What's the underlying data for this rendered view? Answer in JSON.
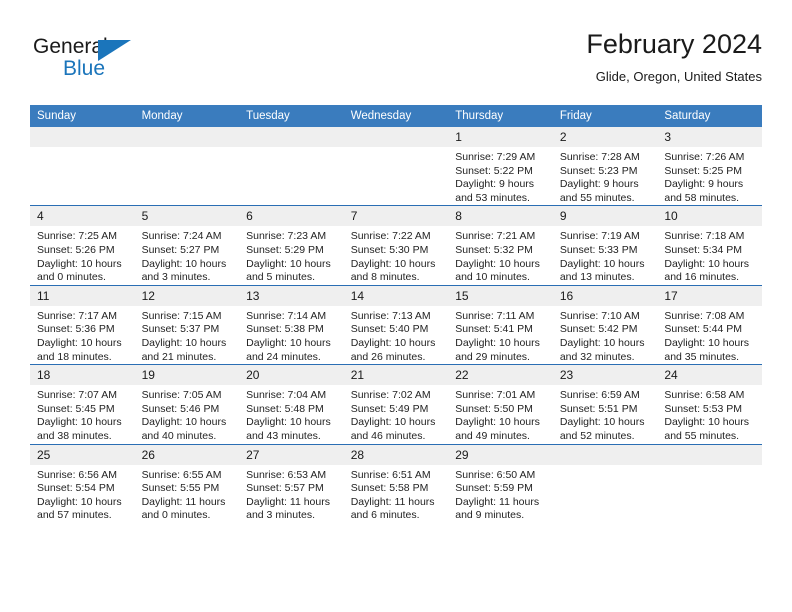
{
  "logo": {
    "word1": "General",
    "word2": "Blue",
    "triangle_color": "#1b75bb",
    "icon": "general-blue-logo"
  },
  "header": {
    "title": "February 2024",
    "location": "Glide, Oregon, United States"
  },
  "calendar": {
    "header_bg": "#3a7cbe",
    "row_divider_color": "#2a6eb4",
    "daynum_bg": "#efefef",
    "weekday_headers": [
      "Sunday",
      "Monday",
      "Tuesday",
      "Wednesday",
      "Thursday",
      "Friday",
      "Saturday"
    ],
    "weeks": [
      [
        {
          "day": "",
          "lines": []
        },
        {
          "day": "",
          "lines": []
        },
        {
          "day": "",
          "lines": []
        },
        {
          "day": "",
          "lines": []
        },
        {
          "day": "1",
          "lines": [
            "Sunrise: 7:29 AM",
            "Sunset: 5:22 PM",
            "Daylight: 9 hours and 53 minutes."
          ]
        },
        {
          "day": "2",
          "lines": [
            "Sunrise: 7:28 AM",
            "Sunset: 5:23 PM",
            "Daylight: 9 hours and 55 minutes."
          ]
        },
        {
          "day": "3",
          "lines": [
            "Sunrise: 7:26 AM",
            "Sunset: 5:25 PM",
            "Daylight: 9 hours and 58 minutes."
          ]
        }
      ],
      [
        {
          "day": "4",
          "lines": [
            "Sunrise: 7:25 AM",
            "Sunset: 5:26 PM",
            "Daylight: 10 hours and 0 minutes."
          ]
        },
        {
          "day": "5",
          "lines": [
            "Sunrise: 7:24 AM",
            "Sunset: 5:27 PM",
            "Daylight: 10 hours and 3 minutes."
          ]
        },
        {
          "day": "6",
          "lines": [
            "Sunrise: 7:23 AM",
            "Sunset: 5:29 PM",
            "Daylight: 10 hours and 5 minutes."
          ]
        },
        {
          "day": "7",
          "lines": [
            "Sunrise: 7:22 AM",
            "Sunset: 5:30 PM",
            "Daylight: 10 hours and 8 minutes."
          ]
        },
        {
          "day": "8",
          "lines": [
            "Sunrise: 7:21 AM",
            "Sunset: 5:32 PM",
            "Daylight: 10 hours and 10 minutes."
          ]
        },
        {
          "day": "9",
          "lines": [
            "Sunrise: 7:19 AM",
            "Sunset: 5:33 PM",
            "Daylight: 10 hours and 13 minutes."
          ]
        },
        {
          "day": "10",
          "lines": [
            "Sunrise: 7:18 AM",
            "Sunset: 5:34 PM",
            "Daylight: 10 hours and 16 minutes."
          ]
        }
      ],
      [
        {
          "day": "11",
          "lines": [
            "Sunrise: 7:17 AM",
            "Sunset: 5:36 PM",
            "Daylight: 10 hours and 18 minutes."
          ]
        },
        {
          "day": "12",
          "lines": [
            "Sunrise: 7:15 AM",
            "Sunset: 5:37 PM",
            "Daylight: 10 hours and 21 minutes."
          ]
        },
        {
          "day": "13",
          "lines": [
            "Sunrise: 7:14 AM",
            "Sunset: 5:38 PM",
            "Daylight: 10 hours and 24 minutes."
          ]
        },
        {
          "day": "14",
          "lines": [
            "Sunrise: 7:13 AM",
            "Sunset: 5:40 PM",
            "Daylight: 10 hours and 26 minutes."
          ]
        },
        {
          "day": "15",
          "lines": [
            "Sunrise: 7:11 AM",
            "Sunset: 5:41 PM",
            "Daylight: 10 hours and 29 minutes."
          ]
        },
        {
          "day": "16",
          "lines": [
            "Sunrise: 7:10 AM",
            "Sunset: 5:42 PM",
            "Daylight: 10 hours and 32 minutes."
          ]
        },
        {
          "day": "17",
          "lines": [
            "Sunrise: 7:08 AM",
            "Sunset: 5:44 PM",
            "Daylight: 10 hours and 35 minutes."
          ]
        }
      ],
      [
        {
          "day": "18",
          "lines": [
            "Sunrise: 7:07 AM",
            "Sunset: 5:45 PM",
            "Daylight: 10 hours and 38 minutes."
          ]
        },
        {
          "day": "19",
          "lines": [
            "Sunrise: 7:05 AM",
            "Sunset: 5:46 PM",
            "Daylight: 10 hours and 40 minutes."
          ]
        },
        {
          "day": "20",
          "lines": [
            "Sunrise: 7:04 AM",
            "Sunset: 5:48 PM",
            "Daylight: 10 hours and 43 minutes."
          ]
        },
        {
          "day": "21",
          "lines": [
            "Sunrise: 7:02 AM",
            "Sunset: 5:49 PM",
            "Daylight: 10 hours and 46 minutes."
          ]
        },
        {
          "day": "22",
          "lines": [
            "Sunrise: 7:01 AM",
            "Sunset: 5:50 PM",
            "Daylight: 10 hours and 49 minutes."
          ]
        },
        {
          "day": "23",
          "lines": [
            "Sunrise: 6:59 AM",
            "Sunset: 5:51 PM",
            "Daylight: 10 hours and 52 minutes."
          ]
        },
        {
          "day": "24",
          "lines": [
            "Sunrise: 6:58 AM",
            "Sunset: 5:53 PM",
            "Daylight: 10 hours and 55 minutes."
          ]
        }
      ],
      [
        {
          "day": "25",
          "lines": [
            "Sunrise: 6:56 AM",
            "Sunset: 5:54 PM",
            "Daylight: 10 hours and 57 minutes."
          ]
        },
        {
          "day": "26",
          "lines": [
            "Sunrise: 6:55 AM",
            "Sunset: 5:55 PM",
            "Daylight: 11 hours and 0 minutes."
          ]
        },
        {
          "day": "27",
          "lines": [
            "Sunrise: 6:53 AM",
            "Sunset: 5:57 PM",
            "Daylight: 11 hours and 3 minutes."
          ]
        },
        {
          "day": "28",
          "lines": [
            "Sunrise: 6:51 AM",
            "Sunset: 5:58 PM",
            "Daylight: 11 hours and 6 minutes."
          ]
        },
        {
          "day": "29",
          "lines": [
            "Sunrise: 6:50 AM",
            "Sunset: 5:59 PM",
            "Daylight: 11 hours and 9 minutes."
          ]
        },
        {
          "day": "",
          "lines": []
        },
        {
          "day": "",
          "lines": []
        }
      ]
    ]
  }
}
